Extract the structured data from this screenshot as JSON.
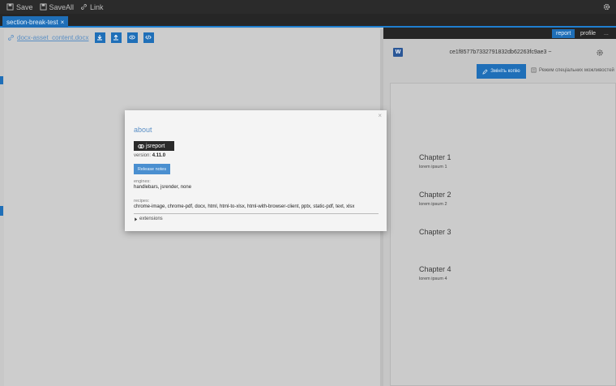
{
  "toolbar": {
    "save_label": "Save",
    "saveall_label": "SaveAll",
    "link_label": "Link"
  },
  "tabs": [
    {
      "label": "section-break-test",
      "close": "×"
    }
  ],
  "editor": {
    "doc_link": "docx-asset_content.docx"
  },
  "preview": {
    "tabs": {
      "report": "report",
      "profile": "profile",
      "more": "..."
    },
    "word_logo": "W",
    "doc_id": "ce1f8577b7332791832db62263fc9ae3 ~",
    "edit_copy_label": "Змініть копію",
    "accessibility_label": "Режим спеціальних можливостей",
    "chapters": [
      {
        "title": "Chapter 1",
        "text": "lorem ipsum 1"
      },
      {
        "title": "Chapter 2",
        "text": "lorem ipsum 2"
      },
      {
        "title": "Chapter 3",
        "text": ""
      },
      {
        "title": "Chapter 4",
        "text": "lorem ipsum 4"
      }
    ]
  },
  "about": {
    "close": "×",
    "title": "about",
    "logo_text": "jsreport",
    "version_label": "version:",
    "version_value": "4.11.0",
    "release_notes": "Release notes",
    "engines_label": "engines:",
    "engines_value": "handlebars, jsrender, none",
    "recipes_label": "recipes:",
    "recipes_value": "chrome-image, chrome-pdf, docx, html, html-to-xlsx, html-with-browser-client, pptx, static-pdf, text, xlsx",
    "extensions_label": "extensions"
  },
  "colors": {
    "accent": "#1f6fb8",
    "toolbar_bg": "#2b2b2b",
    "link": "#5a8fc6"
  }
}
